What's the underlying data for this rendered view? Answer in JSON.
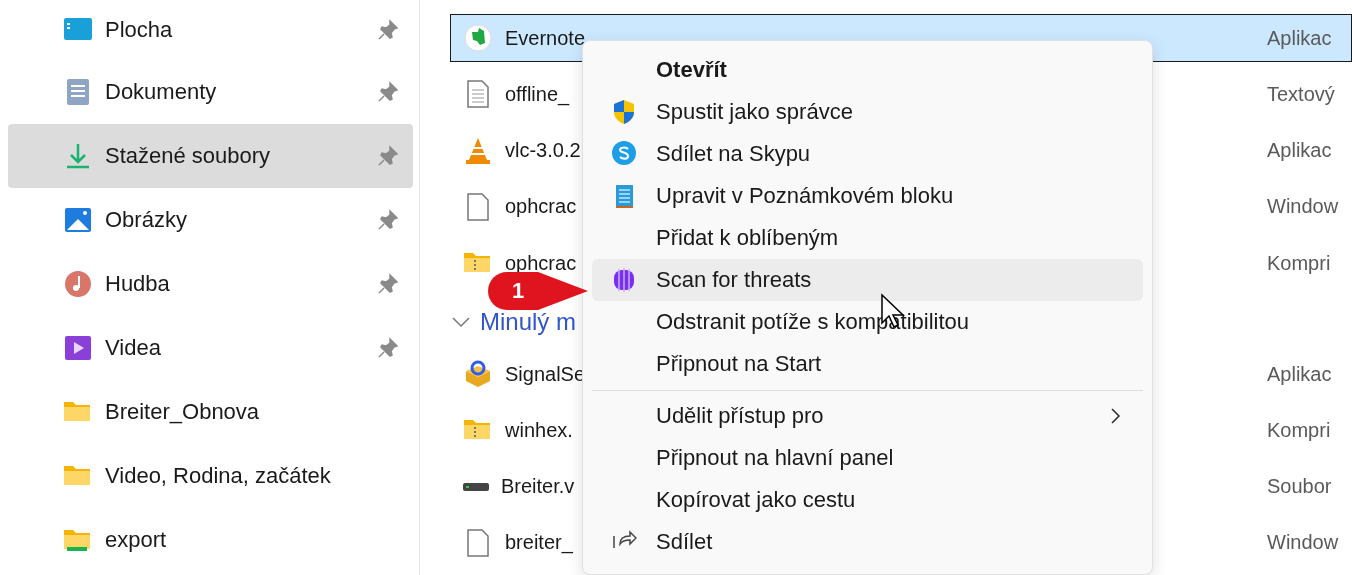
{
  "sidebar": {
    "items": [
      {
        "label": "Plocha",
        "pinned": true,
        "selected": false
      },
      {
        "label": "Dokumenty",
        "pinned": true,
        "selected": false
      },
      {
        "label": "Stažené soubory",
        "pinned": true,
        "selected": true
      },
      {
        "label": "Obrázky",
        "pinned": true,
        "selected": false
      },
      {
        "label": "Hudba",
        "pinned": true,
        "selected": false
      },
      {
        "label": "Videa",
        "pinned": true,
        "selected": false
      },
      {
        "label": "Breiter_Obnova",
        "pinned": false,
        "selected": false
      },
      {
        "label": "Video, Rodina, začátek",
        "pinned": false,
        "selected": false
      },
      {
        "label": "export",
        "pinned": false,
        "selected": false
      }
    ]
  },
  "file_list": {
    "rows": [
      {
        "kind": "file",
        "name": "Evernote",
        "type": "Aplikac",
        "selected": true
      },
      {
        "kind": "file",
        "name": "offline_",
        "type": "Textový",
        "selected": false
      },
      {
        "kind": "file",
        "name": "vlc-3.0.2",
        "type": "Aplikac",
        "selected": false
      },
      {
        "kind": "file",
        "name": "ophcrac",
        "type": "Window",
        "selected": false
      },
      {
        "kind": "file",
        "name": "ophcrac",
        "type": "Kompri",
        "selected": false
      },
      {
        "kind": "group",
        "name": "Minulý m",
        "expanded": true
      },
      {
        "kind": "file",
        "name": "SignalSe",
        "type": "Aplikac",
        "selected": false
      },
      {
        "kind": "file",
        "name": "winhex.",
        "type": "Kompri",
        "selected": false
      },
      {
        "kind": "file",
        "name": "Breiter.v",
        "type": "Soubor",
        "selected": false
      },
      {
        "kind": "file",
        "name": "breiter_",
        "type": "Window",
        "selected": false
      }
    ]
  },
  "context_menu": {
    "items": [
      {
        "kind": "item",
        "label": "Otevřít",
        "default": true,
        "hovered": false,
        "submenu": false
      },
      {
        "kind": "item",
        "label": "Spustit jako správce",
        "default": false,
        "hovered": false,
        "submenu": false
      },
      {
        "kind": "item",
        "label": "Sdílet na Skypu",
        "default": false,
        "hovered": false,
        "submenu": false
      },
      {
        "kind": "item",
        "label": "Upravit v Poznámkovém bloku",
        "default": false,
        "hovered": false,
        "submenu": false
      },
      {
        "kind": "item",
        "label": "Přidat k oblíbeným",
        "default": false,
        "hovered": false,
        "submenu": false
      },
      {
        "kind": "item",
        "label": "Scan for threats",
        "default": false,
        "hovered": true,
        "submenu": false
      },
      {
        "kind": "item",
        "label": "Odstranit potíže s kompatibilitou",
        "default": false,
        "hovered": false,
        "submenu": false
      },
      {
        "kind": "item",
        "label": "Připnout na Start",
        "default": false,
        "hovered": false,
        "submenu": false
      },
      {
        "kind": "separator"
      },
      {
        "kind": "item",
        "label": "Udělit přístup pro",
        "default": false,
        "hovered": false,
        "submenu": true
      },
      {
        "kind": "item",
        "label": "Připnout na hlavní panel",
        "default": false,
        "hovered": false,
        "submenu": false
      },
      {
        "kind": "item",
        "label": "Kopírovat jako cestu",
        "default": false,
        "hovered": false,
        "submenu": false
      },
      {
        "kind": "item",
        "label": "Sdílet",
        "default": false,
        "hovered": false,
        "submenu": false
      }
    ]
  },
  "callout": {
    "label": "1"
  }
}
